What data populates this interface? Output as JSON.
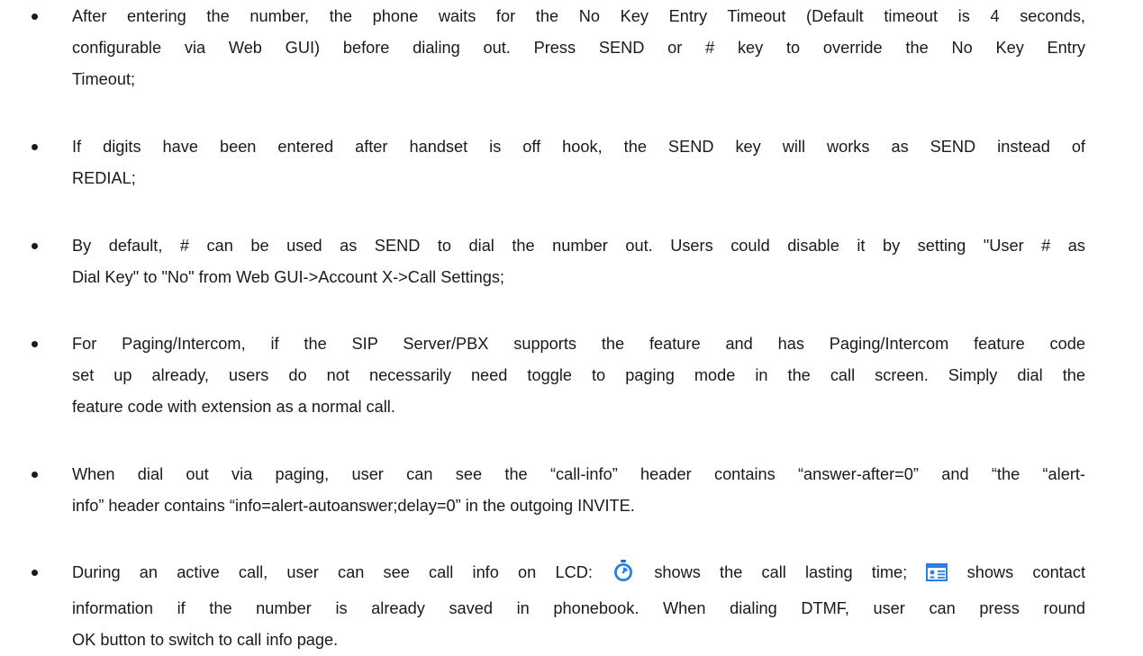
{
  "bullets": [
    {
      "lines": [
        "After entering the number, the phone waits for the No Key Entry Timeout (Default timeout is 4 seconds,",
        "configurable via Web GUI) before dialing out. Press SEND or # key to override the No Key Entry",
        "Timeout;"
      ]
    },
    {
      "lines": [
        "If digits have been entered after handset is off hook, the SEND key will works as SEND instead of",
        "REDIAL;"
      ]
    },
    {
      "lines": [
        "By default, # can be used as SEND to dial the number out. Users could disable it by setting \"User # as",
        "Dial Key\" to \"No\" from Web GUI->Account X->Call Settings;"
      ]
    },
    {
      "lines": [
        "For Paging/Intercom, if the SIP Server/PBX supports the feature and has Paging/Intercom feature code",
        "set up already, users do not necessarily need toggle to paging mode in the call screen. Simply dial the",
        "feature code with extension as a normal call."
      ]
    },
    {
      "lines": [
        "When dial out via paging, user can see the “call-info” header contains “answer-after=0” and “the “alert-",
        "info” header contains “info=alert-autoanswer;delay=0” in the outgoing INVITE."
      ]
    },
    {
      "line1_part1": "During an active call, user can see call info on LCD:",
      "line1_part2": "shows the call lasting time;",
      "line1_part3": "shows contact",
      "lines_rest": [
        "information if the number is already saved in phonebook. When dialing DTMF, user can press round",
        "OK button to switch to call info page."
      ],
      "icons": [
        "timer-icon",
        "contact-card-icon"
      ]
    }
  ]
}
